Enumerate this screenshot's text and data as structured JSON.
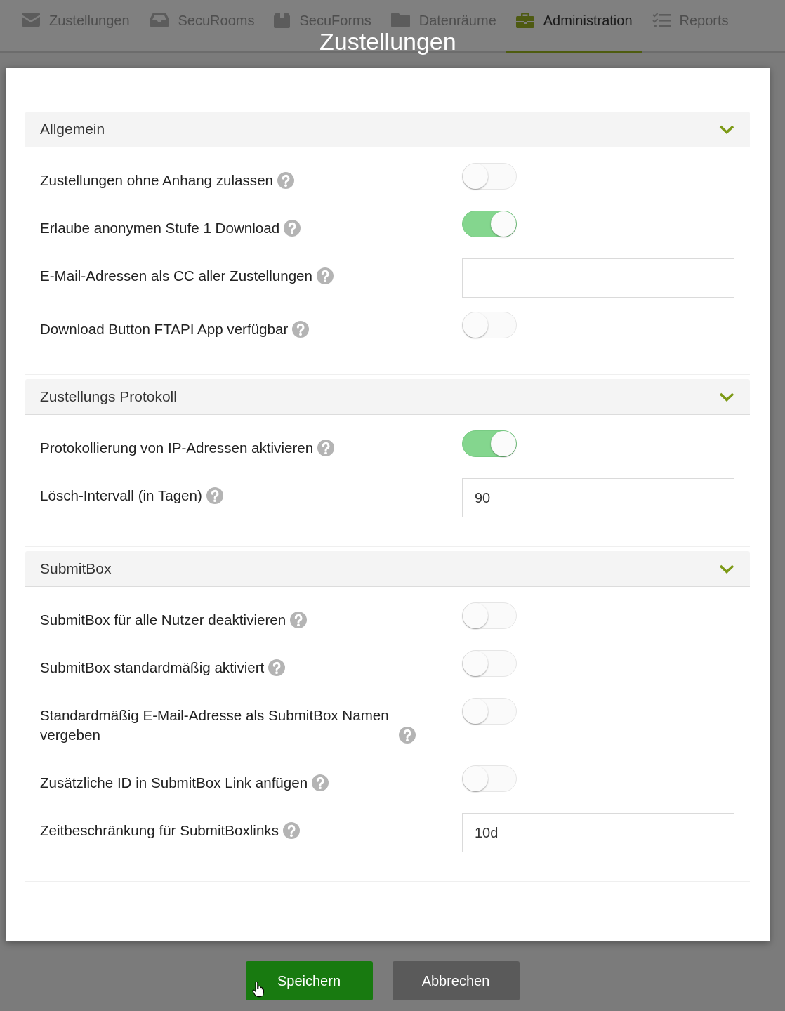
{
  "nav": {
    "tabs": [
      {
        "label": "Zustellungen",
        "selected": false
      },
      {
        "label": "SecuRooms",
        "selected": false
      },
      {
        "label": "SecuForms",
        "selected": false
      },
      {
        "label": "Datenräume",
        "selected": false
      },
      {
        "label": "Administration",
        "selected": true
      },
      {
        "label": "Reports",
        "selected": false
      }
    ]
  },
  "dialog": {
    "title": "Zustellungen",
    "sections": [
      {
        "title": "Allgemein",
        "expanded": true,
        "rows": [
          {
            "kind": "toggle",
            "label": "Zustellungen ohne Anhang zulassen",
            "on": false
          },
          {
            "kind": "toggle",
            "label": "Erlaube anonymen Stufe 1 Download",
            "on": true
          },
          {
            "kind": "input",
            "label": "E-Mail-Adressen als CC aller Zustellungen"
          },
          {
            "kind": "toggle",
            "label": "Download Button FTAPI App verfügbar",
            "on": false
          }
        ]
      },
      {
        "title": "Zustellungs Protokoll",
        "expanded": true,
        "rows": [
          {
            "kind": "toggle",
            "label": "Protokollierung von IP-Adressen aktivieren",
            "on": true
          },
          {
            "kind": "input",
            "label": "Lösch-Intervall (in Tagen)",
            "value": "90"
          }
        ]
      },
      {
        "title": "SubmitBox",
        "expanded": true,
        "rows": [
          {
            "kind": "toggle",
            "label": "SubmitBox für alle Nutzer deaktivieren",
            "on": false
          },
          {
            "kind": "toggle",
            "label": "SubmitBox standardmäßig aktiviert",
            "on": false
          },
          {
            "kind": "toggle",
            "label": "Standardmäßig E-Mail-Adresse als SubmitBox Namen vergeben",
            "on": false
          },
          {
            "kind": "toggle",
            "label": "Zusätzliche ID in SubmitBox Link anfügen",
            "on": false
          },
          {
            "kind": "input",
            "label": "Zeitbeschränkung für SubmitBoxlinks",
            "value": "10d"
          }
        ]
      }
    ]
  },
  "buttons": [
    {
      "kind": "primary",
      "label": "Speichern"
    },
    {
      "kind": "secondary",
      "label": "Abbrechen"
    }
  ]
}
